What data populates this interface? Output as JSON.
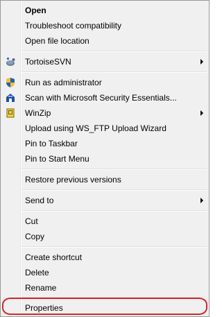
{
  "menu": {
    "items": {
      "open": "Open",
      "troubleshoot": "Troubleshoot compatibility",
      "open_location": "Open file location",
      "tortoisesvn": "TortoiseSVN",
      "run_admin": "Run as administrator",
      "scan_mse": "Scan with Microsoft Security Essentials...",
      "winzip": "WinZip",
      "upload_wsftp": "Upload using WS_FTP Upload Wizard",
      "pin_taskbar": "Pin to Taskbar",
      "pin_start": "Pin to Start Menu",
      "restore": "Restore previous versions",
      "send_to": "Send to",
      "cut": "Cut",
      "copy": "Copy",
      "create_shortcut": "Create shortcut",
      "delete": "Delete",
      "rename": "Rename",
      "properties": "Properties"
    }
  },
  "colors": {
    "menu_bg": "#f0f0f0",
    "highlight_ring": "#d0282e"
  },
  "icons": {
    "tortoisesvn": "tortoisesvn-icon",
    "run_admin": "uac-shield-icon",
    "scan_mse": "security-essentials-icon",
    "winzip": "winzip-icon"
  }
}
